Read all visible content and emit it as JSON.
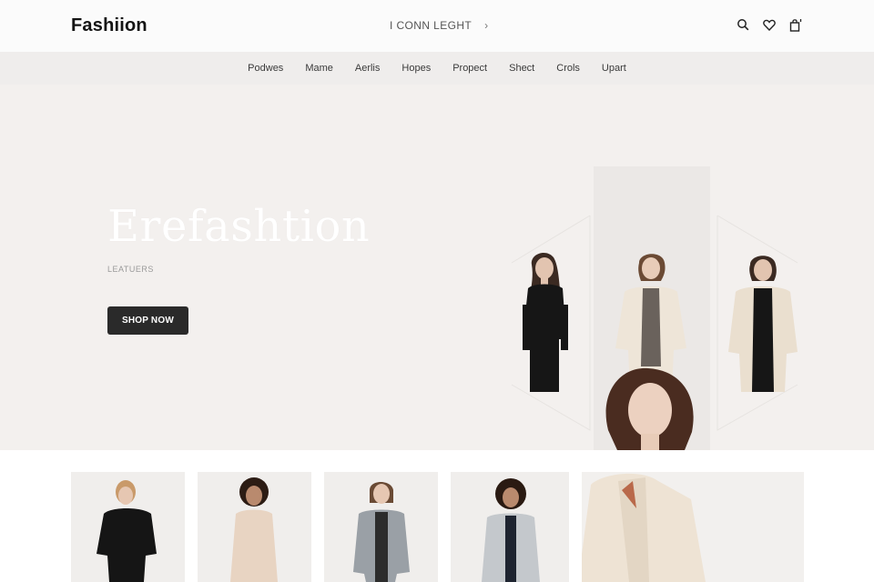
{
  "header": {
    "logo": "Fashiion",
    "promo_text": "I CONN LEGHT",
    "promo_chevron": "›",
    "icons": [
      "search-icon",
      "heart-icon",
      "bag-icon"
    ]
  },
  "nav": {
    "items": [
      "Podwes",
      "Mame",
      "Aerlis",
      "Hopes",
      "Propect",
      "Shect",
      "Crols",
      "Upart"
    ]
  },
  "hero": {
    "title": "Erefashtion",
    "subtitle": "LEATUERS",
    "cta": "SHOP NOW"
  },
  "colors": {
    "hero_bg": "#f3f0ee",
    "nav_bg": "#efedec",
    "button_bg": "#2a2a2a",
    "coat": "#e9e0d2",
    "black": "#161616"
  }
}
